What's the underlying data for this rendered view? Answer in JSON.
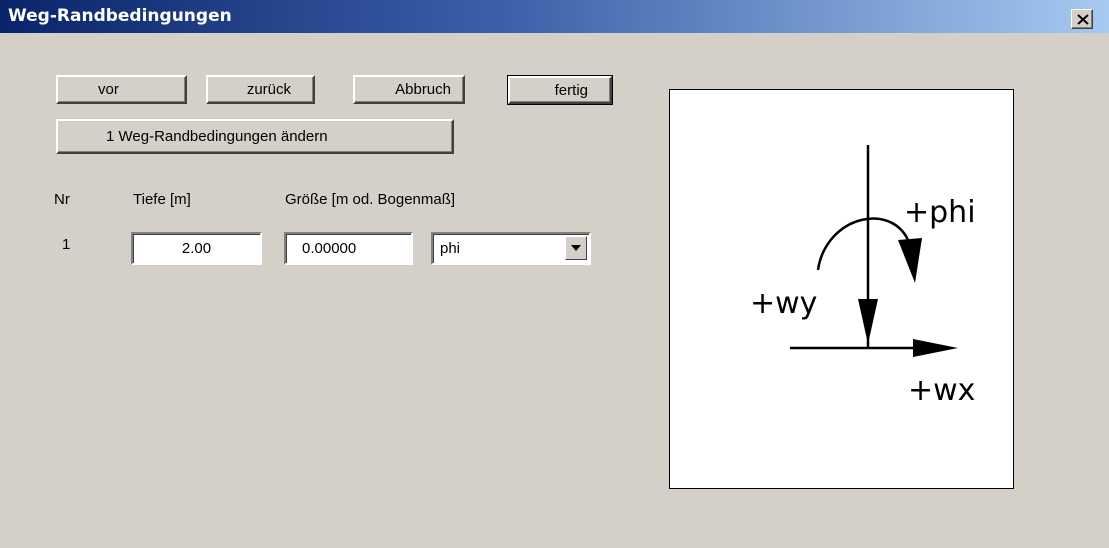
{
  "window": {
    "title": "Weg-Randbedingungen"
  },
  "buttons": {
    "vor": "vor",
    "zurueck": "zurück",
    "abbruch": "Abbruch",
    "fertig": "fertig",
    "aendern": "1 Weg-Randbedingungen ändern"
  },
  "table": {
    "headers": {
      "nr": "Nr",
      "tiefe": "Tiefe [m]",
      "groesse": "Größe [m od. Bogenmaß]"
    },
    "rows": [
      {
        "nr": "1",
        "tiefe": "2.00",
        "groesse": "0.00000",
        "type": "phi"
      }
    ]
  },
  "diagram": {
    "labels": {
      "phi": "+phi",
      "wy": "+wy",
      "wx": "+wx"
    }
  },
  "colors": {
    "titlebar_start": "#0a246a",
    "titlebar_end": "#a6caf0",
    "face": "#d4d0c8"
  }
}
